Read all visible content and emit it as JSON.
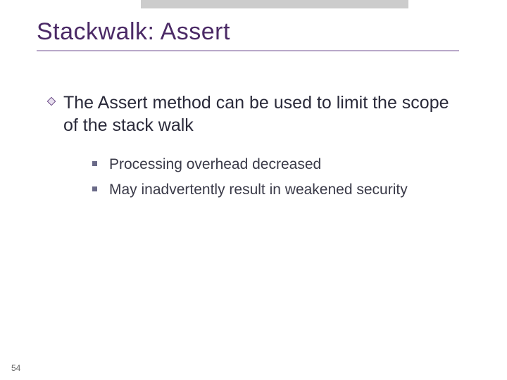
{
  "title": "Stackwalk: Assert",
  "main_point": "The Assert method can be used to limit the scope of the stack walk",
  "sub_points": {
    "a": "Processing overhead decreased",
    "b": "May inadvertently result in weakened security"
  },
  "page_number": "54",
  "colors": {
    "title": "#4b2a66",
    "underline": "#b9a8c9",
    "bullet": "#6a6a88"
  }
}
